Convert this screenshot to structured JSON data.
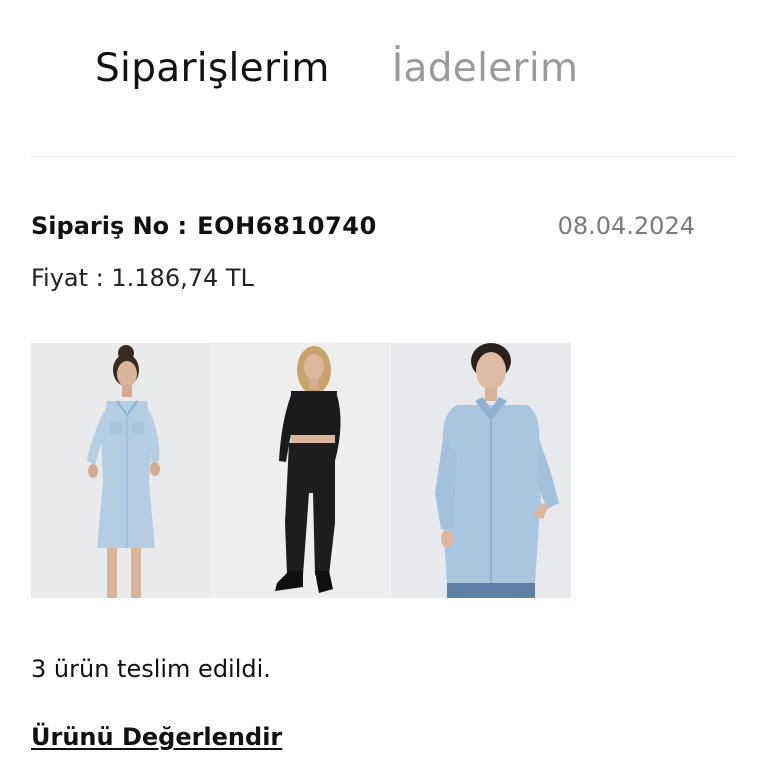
{
  "tabs": [
    {
      "label": "Siparişlerim",
      "active": true
    },
    {
      "label": "İadelerim",
      "active": false
    }
  ],
  "order": {
    "number_label": "Sipariş No :",
    "number": "EOH6810740",
    "date": "08.04.2024",
    "price": "Fiyat : 1.186,74 TL",
    "products": [
      {
        "name": "denim-shirt-dress-image"
      },
      {
        "name": "black-top-and-jeans-image"
      },
      {
        "name": "denim-shirt-image"
      }
    ],
    "status": "3 ürün teslim edildi.",
    "review_label": "Ürünü Değerlendir"
  },
  "colors": {
    "text": "#111111",
    "muted": "#9a9a9a",
    "date": "#7a7a7a",
    "divider": "#ececec",
    "denim": "#a9c4dd",
    "black": "#1a1a1a"
  }
}
